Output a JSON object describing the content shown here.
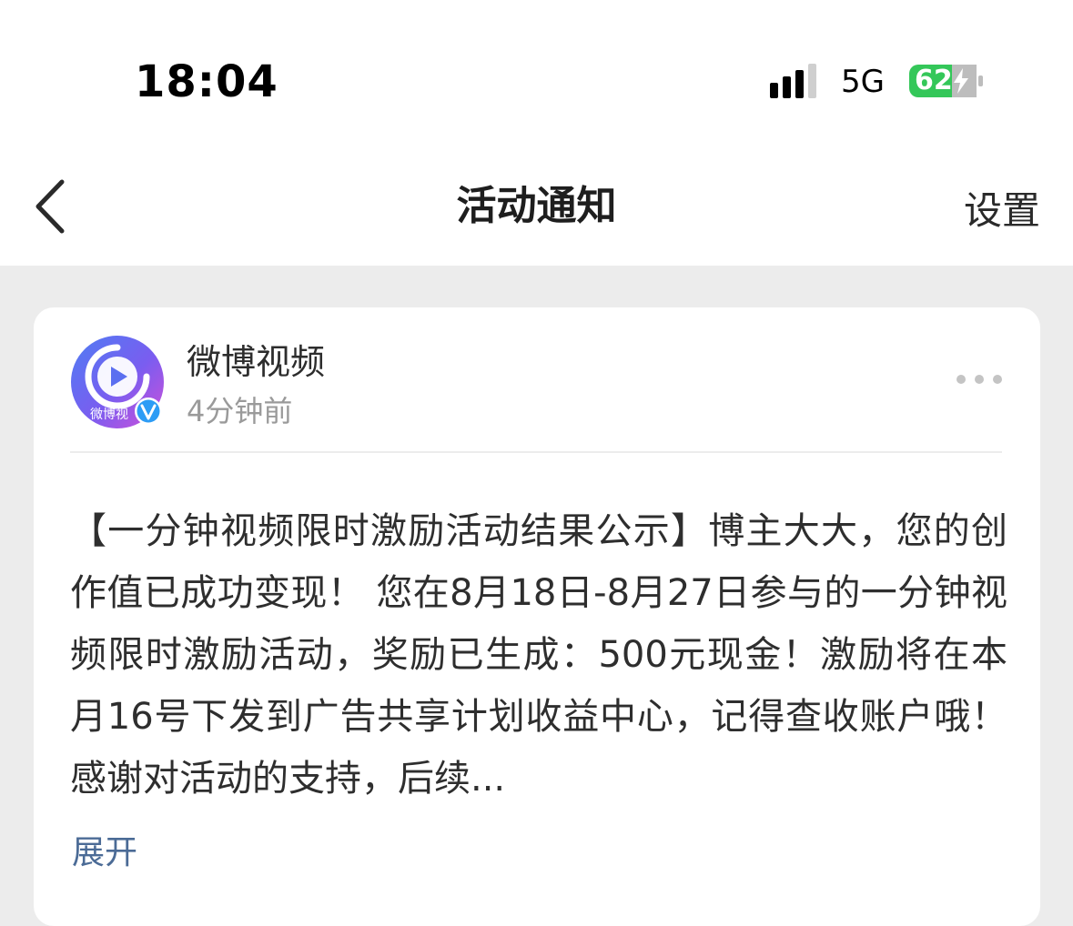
{
  "status_bar": {
    "time": "18:04",
    "network": "5G",
    "battery": "62"
  },
  "nav": {
    "title": "活动通知",
    "settings_label": "设置"
  },
  "notification": {
    "sender": "微博视频",
    "avatar_caption": "微博视",
    "time": "4分钟前",
    "message": "【一分钟视频限时激励活动结果公示】博主大大，您的创作值已成功变现！ 您在8月18日-8月27日参与的一分钟视频限时激励活动，奖励已生成：500元现金！激励将在本月16号下发到广告共享计划收益中心，记得查收账户哦！感谢对活动的支持，后续...",
    "expand_label": "展开"
  },
  "colors": {
    "battery_green": "#34c759",
    "link": "#4b6b96",
    "verified_blue": "#2d9cf5"
  }
}
